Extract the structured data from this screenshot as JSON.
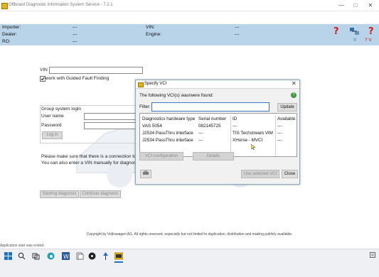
{
  "window": {
    "title": "Offboard Diagnostic Information System Service - 7.2.1"
  },
  "header": {
    "importer_label": "Importer:",
    "importer_value": "---",
    "dealer_label": "Dealer:",
    "dealer_value": "---",
    "ro_label": "RO:",
    "ro_value": "---",
    "vin_label": "VIN:",
    "vin_value": "---",
    "engine_label": "Engine:",
    "engine_value": "---",
    "icons": [
      "help-icon",
      "network-icon",
      "help-vin-icon"
    ],
    "icon_sub1": "V",
    "icon_sub2": "? V"
  },
  "main": {
    "vin_label": "VIN",
    "vin_value": "",
    "guided_checkbox_label": "work with Guided Fault Finding",
    "guided_checked": true,
    "group_login_label": "Group system login",
    "username_label": "User name",
    "password_label": "Password",
    "login_button": "Log in",
    "info_line1": "Please make sure that there is a connection to th",
    "info_line2": "You can also enter a VIN manually for diagnostic",
    "start_button": "Starting diagnosis",
    "continue_button": "Continue diagnosis",
    "copyright": "Copyright by Volkswagen AG. All rights reserved, especially but not limited to duplication, distribution and making publicly available.",
    "status": "Application start was ended."
  },
  "dialog": {
    "title": "Specify VCI",
    "found_text": "The following VCI(s) was/were found:",
    "filter_label": "Filter:",
    "filter_value": "",
    "update_button": "Update",
    "columns": [
      "Diagnostics hardware type",
      "Serial number",
      "ID",
      "Available"
    ],
    "rows": [
      [
        "VAS 5054",
        "082145725",
        "---",
        "---"
      ],
      [
        "J2534 PassThru interface",
        "---",
        "TIS Techstream VIM",
        "---"
      ],
      [
        "J2534 PassThru interface",
        "---",
        "XHorse - MVCI",
        "---"
      ]
    ],
    "vci_config_button": "VCI configuration",
    "details_button": "Details",
    "use_selected_button": "Use selected VCI",
    "close_button": "Close"
  },
  "taskbar": {
    "items": [
      "start-icon",
      "search-icon",
      "task-view-icon",
      "edge-icon",
      "word-icon",
      "files-icon",
      "media-icon",
      "pin-icon",
      "odis-icon"
    ]
  },
  "colors": {
    "header_band": "#b9d3e8",
    "dialog_border": "#8aa9c2",
    "help_red": "#d11a1a",
    "accent_blue": "#2f6fb0"
  }
}
